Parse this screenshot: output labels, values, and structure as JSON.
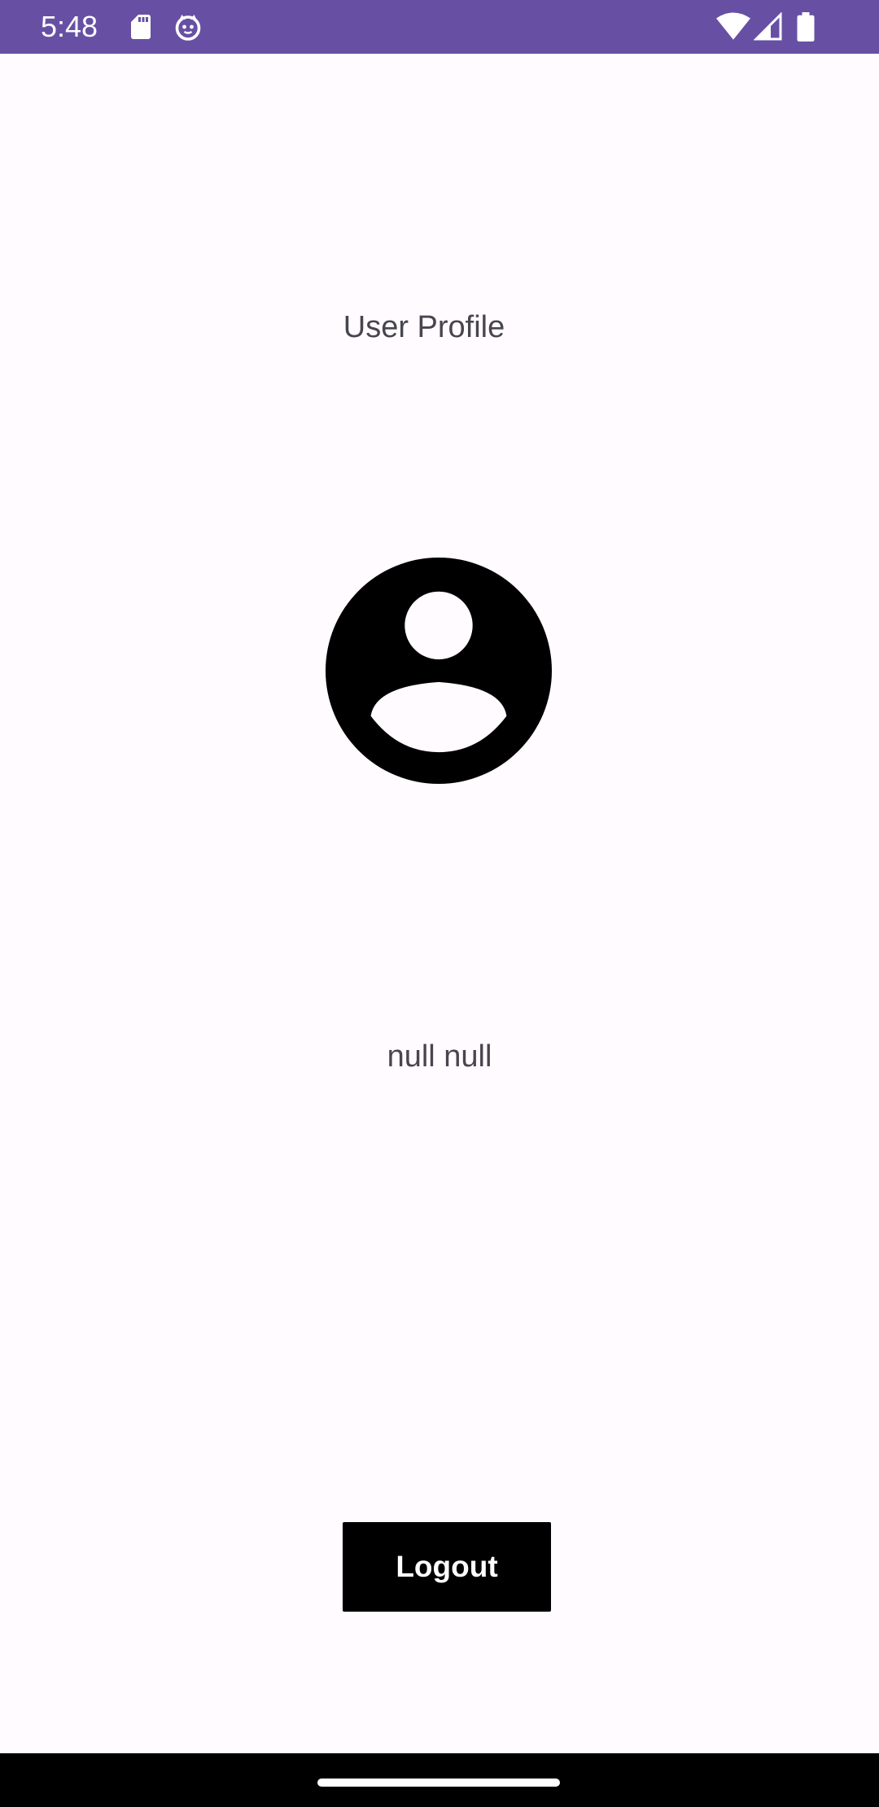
{
  "status_bar": {
    "time": "5:48",
    "icons": [
      "sd-card-icon",
      "cat-notification-icon",
      "wifi-icon",
      "cell-signal-icon",
      "battery-icon"
    ],
    "background_color": "#6750a4"
  },
  "profile": {
    "title": "User Profile",
    "avatar_icon": "account-circle-icon",
    "name": "null null"
  },
  "actions": {
    "logout_label": "Logout"
  },
  "nav_bar": {
    "background_color": "#000000"
  }
}
